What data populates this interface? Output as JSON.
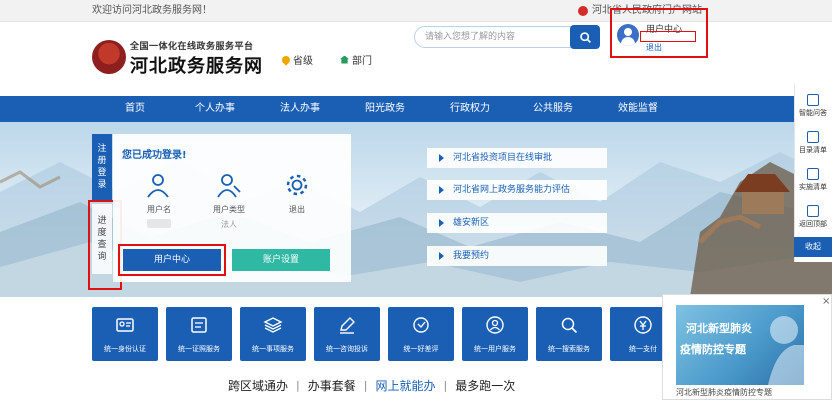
{
  "topbar": {
    "welcome": "欢迎访问河北政务服务网！",
    "gov_portal": "河北省人民政府门户网站"
  },
  "header": {
    "logo_line1": "全国一体化在线政务服务平台",
    "logo_line2": "河北政务服务网",
    "nav_provincial": "省级",
    "nav_departments": "部门",
    "search_placeholder": "请输入您想了解的内容",
    "user_center_title": "用户中心",
    "user_name": "",
    "logout": "退出"
  },
  "navbar": {
    "items": [
      "首页",
      "个人办事",
      "法人办事",
      "阳光政务",
      "行政权力",
      "公共服务",
      "效能监督"
    ]
  },
  "side": {
    "register_login": [
      "注",
      "册",
      "登",
      "录"
    ],
    "progress_query": [
      "进",
      "度",
      "查",
      "询"
    ]
  },
  "login_panel": {
    "title": "您已成功登录!",
    "username_label": "用户名",
    "username_value": "",
    "user_type_label": "用户类型",
    "user_type_value": "法人",
    "logout_label": "退出",
    "user_center_button": "用户中心",
    "account_settings_button": "账户设置"
  },
  "notices": [
    "河北省投资项目在线审批",
    "河北省网上政务服务能力评估",
    "雄安新区",
    "我要预约"
  ],
  "right_dock": {
    "items": [
      "智能问答",
      "目录清单",
      "实施清单",
      "返回顶部"
    ],
    "collapse": "收起"
  },
  "tiles": [
    {
      "label": "统一身份认证",
      "icon": "id-card-icon"
    },
    {
      "label": "统一证照服务",
      "icon": "license-icon"
    },
    {
      "label": "统一事项服务",
      "icon": "layers-icon"
    },
    {
      "label": "统一咨询投诉",
      "icon": "edit-icon"
    },
    {
      "label": "统一好差评",
      "icon": "rating-icon"
    },
    {
      "label": "统一用户服务",
      "icon": "user-service-icon"
    },
    {
      "label": "统一搜索服务",
      "icon": "search-service-icon"
    },
    {
      "label": "统一支付",
      "icon": "payment-icon"
    }
  ],
  "slogan": {
    "part1": "跨区域通办",
    "part2": "办事套餐",
    "part3": "网上就能办",
    "part4": "最多跑一次",
    "separator": "|"
  },
  "promo": {
    "line1": "河北新型肺炎",
    "line2": "疫情防控专题",
    "caption": "河北新型肺炎疫情防控专题",
    "close": "×"
  },
  "colors": {
    "primary": "#1a5fb4",
    "teal": "#2fb8a4",
    "highlight_border": "#e01010"
  }
}
